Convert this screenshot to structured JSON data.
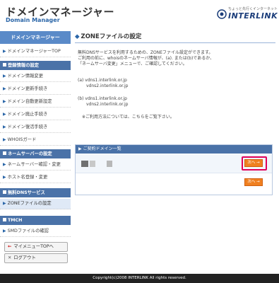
{
  "header": {
    "title": "ドメインマネージャー",
    "subtitle": "Domain Manager",
    "logo_small": "ちょっと先行くインターネット",
    "logo_text": "INTERLINK"
  },
  "sidebar": {
    "main_header": "ドメインマネージャー",
    "top_link": "ドメインマネージャーTOP",
    "sections": [
      {
        "title": "登録情報の設定",
        "items": [
          "ドメイン情報変更",
          "ドメイン更新手続き",
          "ドメイン自動更新設定",
          "ドメイン廃止手続き",
          "ドメイン復活手続き",
          "WHOISガード"
        ]
      },
      {
        "title": "ネームサーバーの設定",
        "items": [
          "ネームサーバー確認・変更",
          "ホスト名登録・変更"
        ]
      },
      {
        "title": "無料DNSサービス",
        "items": [
          "ZONEファイルの設定"
        ]
      },
      {
        "title": "TMCH",
        "items": [
          "SMDファイルの確認"
        ]
      }
    ],
    "menu_top_label": "マイメニューTOPへ",
    "logout_label": "ログアウト"
  },
  "main": {
    "title": "ZONEファイルの設定",
    "intro_lines": [
      "無料DNSサービスを利用するための、ZONEファイル設定ができます。",
      "ご利用の前に、whoisのネームサーバ情報が、(a). または(b)であるか、",
      "「ネームサーバ変更」メニューで、ご確認してください。"
    ],
    "option_a_label": "(a) vdns1.interlink.or.jp",
    "option_a_line2": "vdns2.interlink.or.jp",
    "option_b_label": "(b) vdns1.interlink.or.jp",
    "option_b_line2": "vdns2.interlink.or.jp",
    "note": "※ご利用方法については、こちらをご覧下さい。",
    "panel_title": "ご契約ドメイン一覧",
    "next_button": "次へ →"
  },
  "footer": {
    "copyright": "Copyright(c)2008 INTERLINK All rights reserved."
  },
  "colors": {
    "accent_blue": "#4a72a8",
    "button_orange": "#f08020",
    "highlight_pink": "#e0005a"
  }
}
